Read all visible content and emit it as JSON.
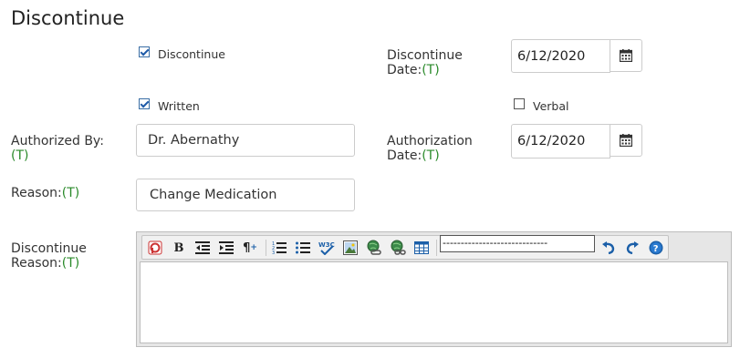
{
  "page": {
    "title": "Discontinue"
  },
  "t_marker": "(T)",
  "discontinue_check": {
    "label": "Discontinue",
    "checked": true
  },
  "written_check": {
    "label": "Written",
    "checked": true
  },
  "verbal_check": {
    "label": "Verbal",
    "checked": false
  },
  "discontinue_date": {
    "label_line1": "Discontinue",
    "label_line2": "Date:",
    "value": "6/12/2020"
  },
  "authorized_by": {
    "label": "Authorized By:",
    "value": "Dr. Abernathy"
  },
  "authorization_date": {
    "label_line1": "Authorization",
    "label_line2": "Date:",
    "value": "6/12/2020"
  },
  "reason": {
    "label": "Reason:",
    "value": "Change Medication"
  },
  "discontinue_reason": {
    "label_line1": "Discontinue",
    "label_line2": "Reason:",
    "format_select_value": "-----------------------------",
    "toolbar_icons": [
      "paste-word-icon",
      "bold-icon",
      "outdent-icon",
      "indent-icon",
      "paragraph-icon",
      "numbered-list-icon",
      "bulleted-list-icon",
      "spellcheck-icon",
      "image-icon",
      "link-icon",
      "unlink-icon",
      "table-icon",
      "undo-icon",
      "redo-icon",
      "help-icon"
    ]
  }
}
